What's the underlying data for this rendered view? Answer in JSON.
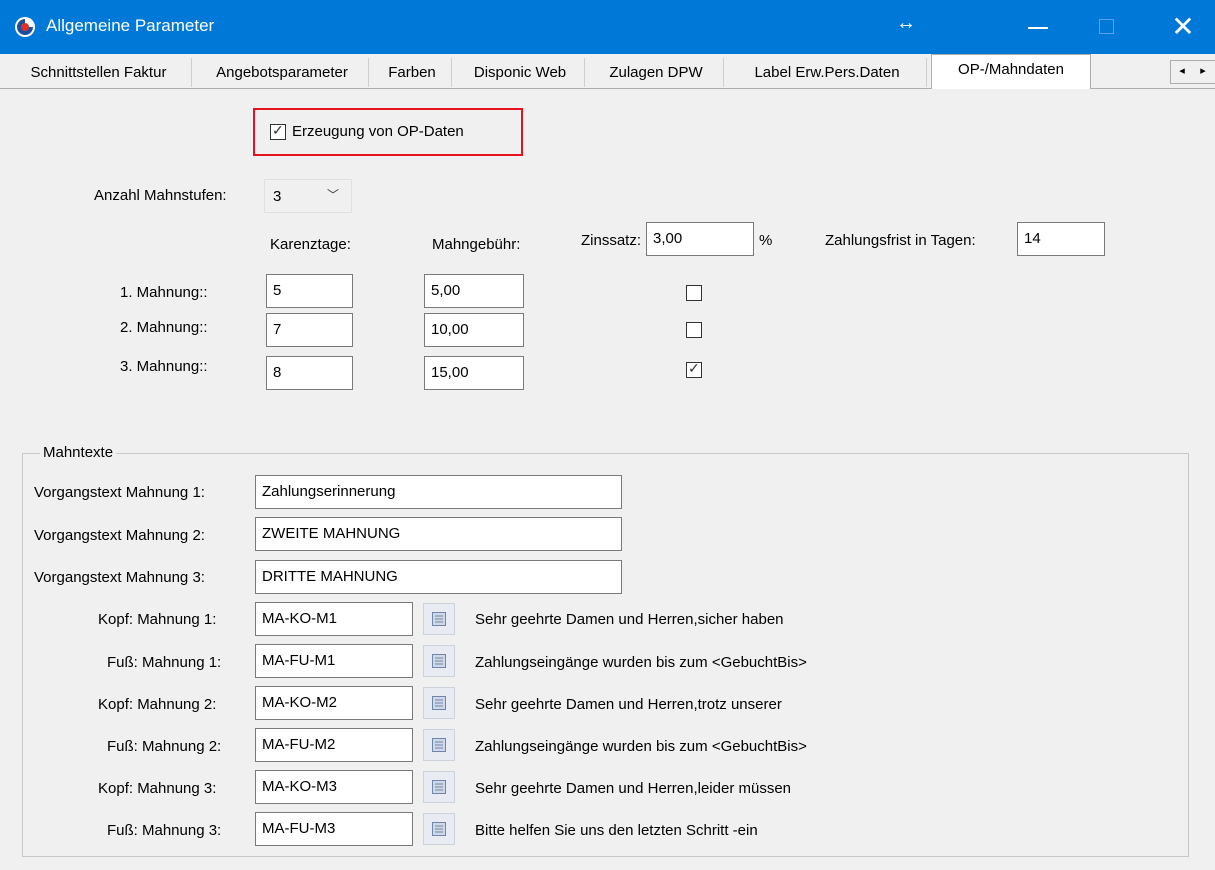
{
  "window": {
    "title": "Allgemeine Parameter",
    "close_glyph": "✕",
    "resize_glyph": "↔"
  },
  "tabs": [
    {
      "label": "Schnittstellen Faktur"
    },
    {
      "label": "Angebotsparameter"
    },
    {
      "label": "Farben"
    },
    {
      "label": "Disponic Web"
    },
    {
      "label": "Zulagen DPW"
    },
    {
      "label": "Label Erw.Pers.Daten"
    },
    {
      "label": "OP-/Mahndaten",
      "active": true
    }
  ],
  "tab_scroll": {
    "left": "◂",
    "right": "▸"
  },
  "op_daten": {
    "label": "Erzeugung von OP-Daten",
    "checked": true
  },
  "mahnstufen": {
    "label": "Anzahl Mahnstufen:",
    "value": "3",
    "chevron": "﹀"
  },
  "headers": {
    "karenztage": "Karenztage:",
    "mahngebuehr": "Mahngebühr:",
    "zinssatz_label": "Zinssatz:",
    "zinssatz_value": "3,00",
    "percent": "%",
    "zahlungsfrist_label": "Zahlungsfrist in Tagen:",
    "zahlungsfrist_value": "14"
  },
  "mahnungen": [
    {
      "label": "1. Mahnung::",
      "karenztage": "5",
      "gebuehr": "5,00",
      "checked": false
    },
    {
      "label": "2. Mahnung::",
      "karenztage": "7",
      "gebuehr": "10,00",
      "checked": false
    },
    {
      "label": "3. Mahnung::",
      "karenztage": "8",
      "gebuehr": "15,00",
      "checked": true
    }
  ],
  "mahntexte": {
    "title": "Mahntexte",
    "vorgang": [
      {
        "label": "Vorgangstext Mahnung 1:",
        "value": "Zahlungserinnerung"
      },
      {
        "label": "Vorgangstext Mahnung 2:",
        "value": "ZWEITE MAHNUNG"
      },
      {
        "label": "Vorgangstext Mahnung 3:",
        "value": "DRITTE MAHNUNG"
      }
    ],
    "texte": [
      {
        "label": "Kopf: Mahnung 1:",
        "code": "MA-KO-M1",
        "preview": "Sehr geehrte Damen und Herren,sicher haben"
      },
      {
        "label": "Fuß: Mahnung 1:",
        "code": "MA-FU-M1",
        "preview": "Zahlungseingänge wurden bis zum <GebuchtBis>"
      },
      {
        "label": "Kopf: Mahnung 2:",
        "code": "MA-KO-M2",
        "preview": "Sehr geehrte Damen und Herren,trotz unserer"
      },
      {
        "label": "Fuß: Mahnung 2:",
        "code": "MA-FU-M2",
        "preview": "Zahlungseingänge wurden bis zum <GebuchtBis>"
      },
      {
        "label": "Kopf: Mahnung 3:",
        "code": "MA-KO-M3",
        "preview": "Sehr geehrte Damen und Herren,leider müssen"
      },
      {
        "label": "Fuß: Mahnung 3:",
        "code": "MA-FU-M3",
        "preview": "Bitte helfen Sie uns den letzten Schritt -ein"
      }
    ]
  },
  "colors": {
    "titlebar": "#0078d7",
    "highlight": "#e81123"
  }
}
